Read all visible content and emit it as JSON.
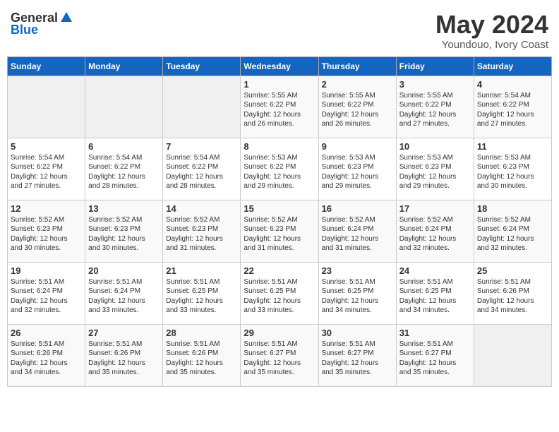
{
  "logo": {
    "general": "General",
    "blue": "Blue"
  },
  "title": "May 2024",
  "subtitle": "Youndouo, Ivory Coast",
  "days_header": [
    "Sunday",
    "Monday",
    "Tuesday",
    "Wednesday",
    "Thursday",
    "Friday",
    "Saturday"
  ],
  "weeks": [
    [
      {
        "day": "",
        "info": ""
      },
      {
        "day": "",
        "info": ""
      },
      {
        "day": "",
        "info": ""
      },
      {
        "day": "1",
        "info": "Sunrise: 5:55 AM\nSunset: 6:22 PM\nDaylight: 12 hours\nand 26 minutes."
      },
      {
        "day": "2",
        "info": "Sunrise: 5:55 AM\nSunset: 6:22 PM\nDaylight: 12 hours\nand 26 minutes."
      },
      {
        "day": "3",
        "info": "Sunrise: 5:55 AM\nSunset: 6:22 PM\nDaylight: 12 hours\nand 27 minutes."
      },
      {
        "day": "4",
        "info": "Sunrise: 5:54 AM\nSunset: 6:22 PM\nDaylight: 12 hours\nand 27 minutes."
      }
    ],
    [
      {
        "day": "5",
        "info": "Sunrise: 5:54 AM\nSunset: 6:22 PM\nDaylight: 12 hours\nand 27 minutes."
      },
      {
        "day": "6",
        "info": "Sunrise: 5:54 AM\nSunset: 6:22 PM\nDaylight: 12 hours\nand 28 minutes."
      },
      {
        "day": "7",
        "info": "Sunrise: 5:54 AM\nSunset: 6:22 PM\nDaylight: 12 hours\nand 28 minutes."
      },
      {
        "day": "8",
        "info": "Sunrise: 5:53 AM\nSunset: 6:22 PM\nDaylight: 12 hours\nand 29 minutes."
      },
      {
        "day": "9",
        "info": "Sunrise: 5:53 AM\nSunset: 6:23 PM\nDaylight: 12 hours\nand 29 minutes."
      },
      {
        "day": "10",
        "info": "Sunrise: 5:53 AM\nSunset: 6:23 PM\nDaylight: 12 hours\nand 29 minutes."
      },
      {
        "day": "11",
        "info": "Sunrise: 5:53 AM\nSunset: 6:23 PM\nDaylight: 12 hours\nand 30 minutes."
      }
    ],
    [
      {
        "day": "12",
        "info": "Sunrise: 5:52 AM\nSunset: 6:23 PM\nDaylight: 12 hours\nand 30 minutes."
      },
      {
        "day": "13",
        "info": "Sunrise: 5:52 AM\nSunset: 6:23 PM\nDaylight: 12 hours\nand 30 minutes."
      },
      {
        "day": "14",
        "info": "Sunrise: 5:52 AM\nSunset: 6:23 PM\nDaylight: 12 hours\nand 31 minutes."
      },
      {
        "day": "15",
        "info": "Sunrise: 5:52 AM\nSunset: 6:23 PM\nDaylight: 12 hours\nand 31 minutes."
      },
      {
        "day": "16",
        "info": "Sunrise: 5:52 AM\nSunset: 6:24 PM\nDaylight: 12 hours\nand 31 minutes."
      },
      {
        "day": "17",
        "info": "Sunrise: 5:52 AM\nSunset: 6:24 PM\nDaylight: 12 hours\nand 32 minutes."
      },
      {
        "day": "18",
        "info": "Sunrise: 5:52 AM\nSunset: 6:24 PM\nDaylight: 12 hours\nand 32 minutes."
      }
    ],
    [
      {
        "day": "19",
        "info": "Sunrise: 5:51 AM\nSunset: 6:24 PM\nDaylight: 12 hours\nand 32 minutes."
      },
      {
        "day": "20",
        "info": "Sunrise: 5:51 AM\nSunset: 6:24 PM\nDaylight: 12 hours\nand 33 minutes."
      },
      {
        "day": "21",
        "info": "Sunrise: 5:51 AM\nSunset: 6:25 PM\nDaylight: 12 hours\nand 33 minutes."
      },
      {
        "day": "22",
        "info": "Sunrise: 5:51 AM\nSunset: 6:25 PM\nDaylight: 12 hours\nand 33 minutes."
      },
      {
        "day": "23",
        "info": "Sunrise: 5:51 AM\nSunset: 6:25 PM\nDaylight: 12 hours\nand 34 minutes."
      },
      {
        "day": "24",
        "info": "Sunrise: 5:51 AM\nSunset: 6:25 PM\nDaylight: 12 hours\nand 34 minutes."
      },
      {
        "day": "25",
        "info": "Sunrise: 5:51 AM\nSunset: 6:26 PM\nDaylight: 12 hours\nand 34 minutes."
      }
    ],
    [
      {
        "day": "26",
        "info": "Sunrise: 5:51 AM\nSunset: 6:26 PM\nDaylight: 12 hours\nand 34 minutes."
      },
      {
        "day": "27",
        "info": "Sunrise: 5:51 AM\nSunset: 6:26 PM\nDaylight: 12 hours\nand 35 minutes."
      },
      {
        "day": "28",
        "info": "Sunrise: 5:51 AM\nSunset: 6:26 PM\nDaylight: 12 hours\nand 35 minutes."
      },
      {
        "day": "29",
        "info": "Sunrise: 5:51 AM\nSunset: 6:27 PM\nDaylight: 12 hours\nand 35 minutes."
      },
      {
        "day": "30",
        "info": "Sunrise: 5:51 AM\nSunset: 6:27 PM\nDaylight: 12 hours\nand 35 minutes."
      },
      {
        "day": "31",
        "info": "Sunrise: 5:51 AM\nSunset: 6:27 PM\nDaylight: 12 hours\nand 35 minutes."
      },
      {
        "day": "",
        "info": ""
      }
    ]
  ]
}
